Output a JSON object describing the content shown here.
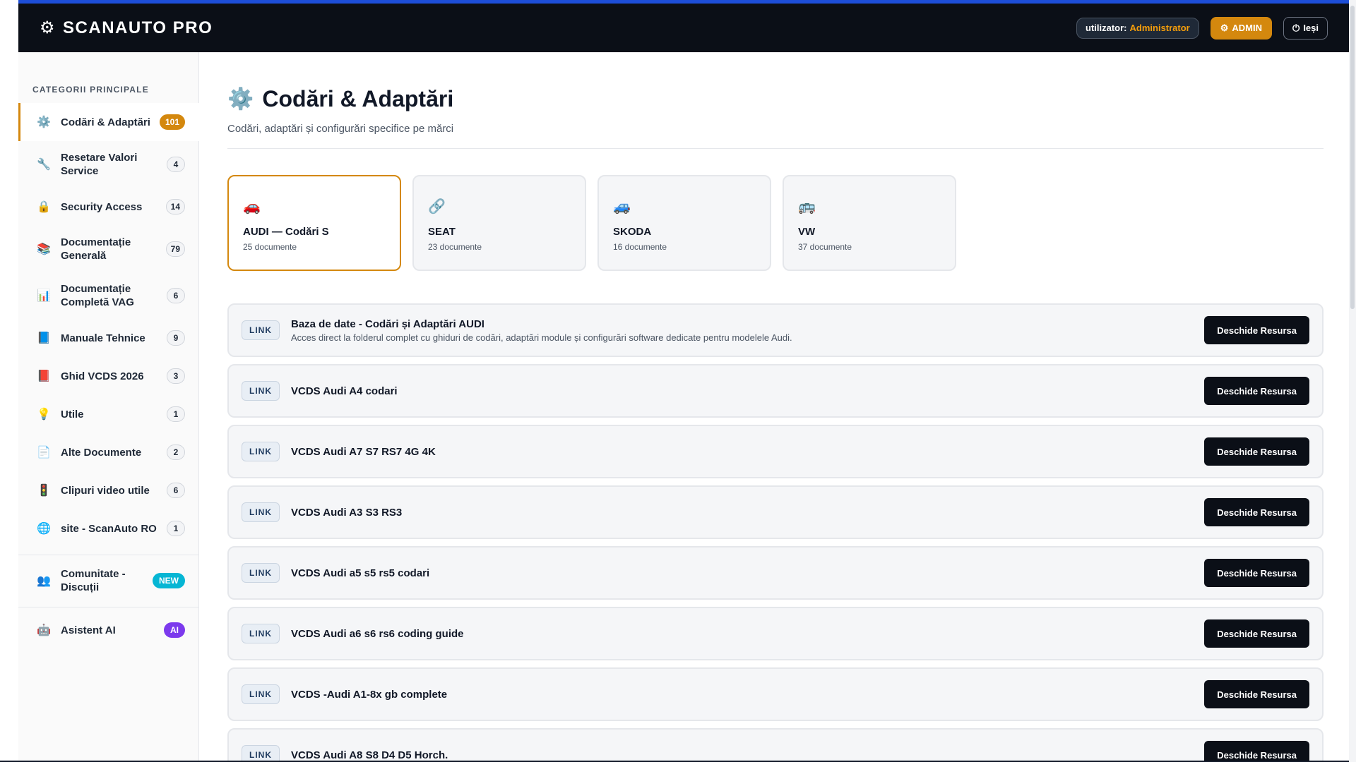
{
  "header": {
    "brand": "SCANAUTO PRO",
    "brand_icon": "gear-icon",
    "user_label": "utilizator:",
    "user_name": "Administrator",
    "admin_label": "ADMIN",
    "exit_label": "Ieși",
    "colors": {
      "bar": "#0b0f17",
      "accent": "#d4880e",
      "top_border": "#1d4ed8"
    }
  },
  "sidebar": {
    "heading": "CATEGORII PRINCIPALE",
    "items": [
      {
        "icon": "gear-icon",
        "label": "Codări & Adaptări",
        "count": "101",
        "active": true
      },
      {
        "icon": "wrench-icon",
        "label": "Resetare Valori Service",
        "count": "4"
      },
      {
        "icon": "lock-icon",
        "label": "Security Access",
        "count": "14"
      },
      {
        "icon": "books-icon",
        "label": "Documentație Generală",
        "count": "79"
      },
      {
        "icon": "chart-icon",
        "label": "Documentație Completă VAG",
        "count": "6"
      },
      {
        "icon": "blue-book-icon",
        "label": "Manuale Tehnice",
        "count": "9"
      },
      {
        "icon": "red-book-icon",
        "label": "Ghid VCDS 2026",
        "count": "3"
      },
      {
        "icon": "lightbulb-icon",
        "label": "Utile",
        "count": "1"
      },
      {
        "icon": "document-icon",
        "label": "Alte Documente",
        "count": "2"
      },
      {
        "icon": "traffic-light-icon",
        "label": "Clipuri video utile",
        "count": "6"
      },
      {
        "icon": "globe-icon",
        "label": "site - ScanAuto RO",
        "count": "1"
      }
    ],
    "community": {
      "icon": "people-icon",
      "label": "Comunitate - Discuții",
      "badge": "NEW"
    },
    "assistant": {
      "icon": "robot-icon",
      "label": "Asistent AI",
      "badge": "AI"
    }
  },
  "main": {
    "title": "Codări & Adaptări",
    "title_icon": "gear-icon",
    "subtitle": "Codări, adaptări și configurări specifice pe mărci",
    "brands": [
      {
        "icon": "red-car-icon",
        "name": "AUDI — Codări S",
        "count": "25 documente",
        "active": true
      },
      {
        "icon": "link-icon",
        "name": "SEAT",
        "count": "23 documente"
      },
      {
        "icon": "blue-car-icon",
        "name": "SKODA",
        "count": "16 documente"
      },
      {
        "icon": "bus-icon",
        "name": "VW",
        "count": "37 documente"
      }
    ],
    "resources": [
      {
        "tag": "LINK",
        "title": "Baza de date - Codări și Adaptări AUDI",
        "desc": "Acces direct la folderul complet cu ghiduri de codări, adaptări module și configurări software dedicate pentru modelele Audi.",
        "action": "Deschide Resursa"
      },
      {
        "tag": "LINK",
        "title": "VCDS Audi A4 codari",
        "desc": "",
        "action": "Deschide Resursa"
      },
      {
        "tag": "LINK",
        "title": "VCDS Audi A7 S7 RS7 4G 4K",
        "desc": "",
        "action": "Deschide Resursa"
      },
      {
        "tag": "LINK",
        "title": "VCDS Audi A3 S3 RS3",
        "desc": "",
        "action": "Deschide Resursa"
      },
      {
        "tag": "LINK",
        "title": "VCDS Audi a5 s5 rs5 codari",
        "desc": "",
        "action": "Deschide Resursa"
      },
      {
        "tag": "LINK",
        "title": "VCDS Audi a6 s6 rs6 coding guide",
        "desc": "",
        "action": "Deschide Resursa"
      },
      {
        "tag": "LINK",
        "title": "VCDS -Audi A1-8x gb complete",
        "desc": "",
        "action": "Deschide Resursa"
      },
      {
        "tag": "LINK",
        "title": "VCDS Audi A8 S8 D4 D5 Horch.",
        "desc": "",
        "action": "Deschide Resursa"
      }
    ]
  }
}
